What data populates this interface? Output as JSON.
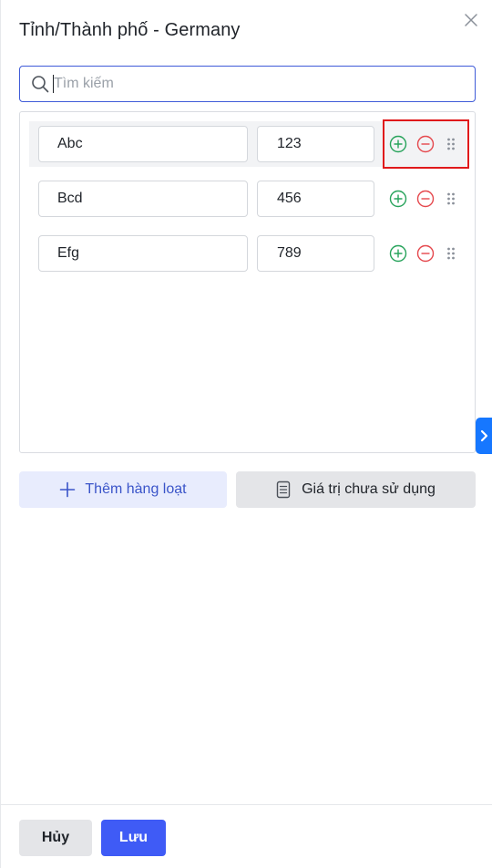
{
  "header": {
    "title": "Tỉnh/Thành phố - Germany"
  },
  "search": {
    "placeholder": "Tìm kiếm",
    "value": ""
  },
  "rows": [
    {
      "name": "Abc",
      "value": "123"
    },
    {
      "name": "Bcd",
      "value": "456"
    },
    {
      "name": "Efg",
      "value": "789"
    }
  ],
  "actions": {
    "bulk_add_label": "Thêm hàng loạt",
    "unused_values_label": "Giá trị chưa sử dụng"
  },
  "footer": {
    "cancel_label": "Hủy",
    "save_label": "Lưu"
  },
  "icons": {
    "close": "close-icon",
    "search": "search-icon",
    "add": "plus-circle-icon",
    "remove": "minus-circle-icon",
    "drag": "drag-handle-icon",
    "side_tab": "chevron-right-icon",
    "bulk_add": "plus-icon",
    "unused": "document-icon"
  },
  "colors": {
    "primary": "#3f5bf6",
    "add_green": "#27a35b",
    "remove_red": "#e5484d",
    "highlight_red": "#e0191b",
    "side_tab_blue": "#1677ff"
  }
}
